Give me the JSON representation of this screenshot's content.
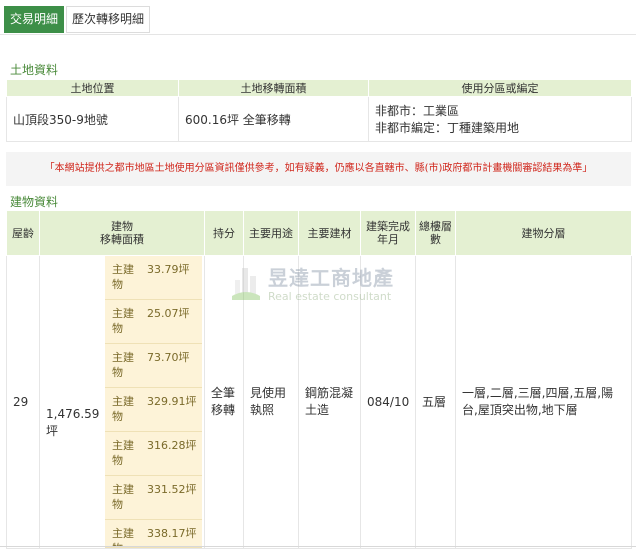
{
  "tabs": [
    {
      "label": "交易明細",
      "active": true
    },
    {
      "label": "歷次轉移明細",
      "active": false
    }
  ],
  "land": {
    "section_title": "土地資料",
    "headers": [
      "土地位置",
      "土地移轉面積",
      "使用分區或編定"
    ],
    "row": {
      "location": "山頂段350-9地號",
      "area": "600.16坪 全筆移轉",
      "zoning_line1": "非都市：工業區",
      "zoning_line2": "非都市編定：丁種建築用地"
    }
  },
  "notice": "「本網站提供之都市地區土地使用分區資訊僅供參考，如有疑義，仍應以各直轄市、縣(市)政府都市計畫機關審認結果為準」",
  "building": {
    "section_title": "建物資料",
    "headers": {
      "age": "屋齡",
      "area_line1": "建物",
      "area_line2": "移轉面積",
      "holding": "持分",
      "main_use": "主要用途",
      "material": "主要建材",
      "completion": "建築完成年月",
      "floors": "總樓層數",
      "layers": "建物分層"
    },
    "row": {
      "age": "29",
      "total_area": "1,476.59坪",
      "holding": "全筆移轉",
      "main_use": "見使用執照",
      "material": "鋼筋混凝土造",
      "completion": "084/10",
      "floors": "五層",
      "layers": "一層,二層,三層,四層,五層,陽台,屋頂突出物,地下層"
    },
    "areas": [
      {
        "type": "主建物",
        "value": "33.79坪"
      },
      {
        "type": "主建物",
        "value": "25.07坪"
      },
      {
        "type": "主建物",
        "value": "73.70坪"
      },
      {
        "type": "主建物",
        "value": "329.91坪"
      },
      {
        "type": "主建物",
        "value": "316.28坪"
      },
      {
        "type": "主建物",
        "value": "331.52坪"
      },
      {
        "type": "主建物",
        "value": "338.17坪"
      }
    ]
  },
  "watermark": {
    "title": "昱達工商地產",
    "subtitle": "Real estate consultant"
  },
  "colors": {
    "accent": "#3d8f48",
    "header_bg": "#e4f0d2",
    "notice_text": "#d0271d",
    "area_bg": "#fdf3d8"
  }
}
